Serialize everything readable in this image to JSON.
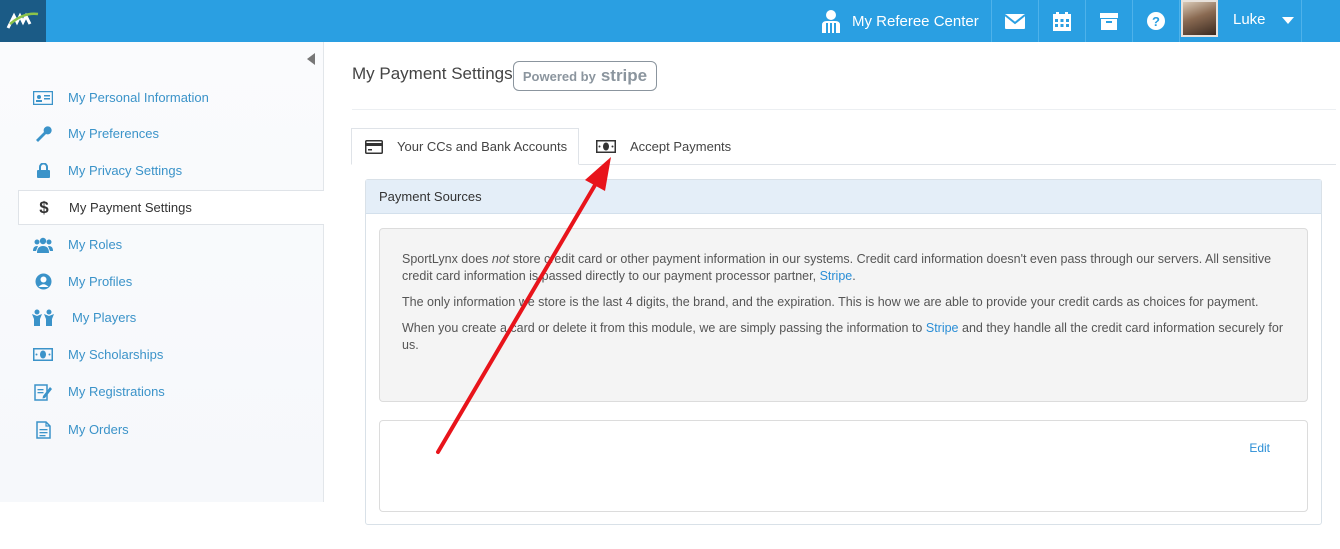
{
  "topbar": {
    "referee_center": "My Referee Center",
    "user_name": "Luke",
    "icons": [
      "mail-icon",
      "calendar-icon",
      "archive-icon",
      "help-icon"
    ]
  },
  "sidebar": {
    "items": [
      {
        "label": "My Personal Information",
        "icon": "id-card-icon"
      },
      {
        "label": "My Preferences",
        "icon": "wrench-icon"
      },
      {
        "label": "My Privacy Settings",
        "icon": "lock-icon"
      },
      {
        "label": "My Payment Settings",
        "icon": "dollar-icon",
        "active": true
      },
      {
        "label": "My Roles",
        "icon": "users-icon"
      },
      {
        "label": "My Profiles",
        "icon": "user-circle-icon"
      },
      {
        "label": "My Players",
        "icon": "players-icon"
      },
      {
        "label": "My Scholarships",
        "icon": "money-icon"
      },
      {
        "label": "My Registrations",
        "icon": "edit-icon"
      },
      {
        "label": "My Orders",
        "icon": "document-icon"
      }
    ]
  },
  "main": {
    "title": "My Payment Settings",
    "badge_powered_by": "Powered by",
    "badge_brand": "stripe",
    "tabs": [
      {
        "label": "Your CCs and Bank Accounts",
        "active": true
      },
      {
        "label": "Accept Payments",
        "active": false
      }
    ],
    "panel_title": "Payment Sources",
    "info": {
      "p1_before": "SportLynx does ",
      "p1_em": "not",
      "p1_after": " store credit card or other payment information in our systems. Credit card information doesn't even pass through our servers. All sensitive credit card information is passed directly to our payment processor partner, ",
      "p1_link": "Stripe",
      "p1_end": ".",
      "p2": "The only information we store is the last 4 digits, the brand, and the expiration. This is how we are able to provide your credit cards as choices for payment.",
      "p3_before": "When you create a card or delete it from this module, we are simply passing the information to ",
      "p3_link": "Stripe",
      "p3_after": " and they handle all the credit card information securely for us."
    },
    "edit_label": "Edit"
  },
  "colors": {
    "topbar": "#2a9fe2",
    "logo_bg": "#1b5b86",
    "link": "#2a8ed6",
    "panel_head": "#e4eef8",
    "annotation_arrow": "#e8141b"
  }
}
